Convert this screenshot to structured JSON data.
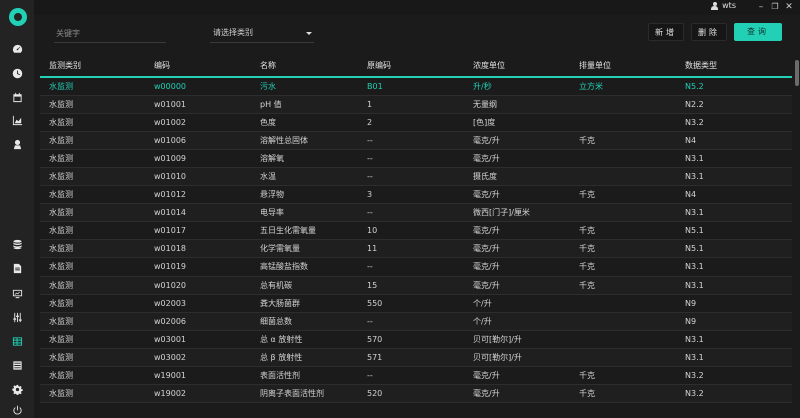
{
  "topbar": {
    "user": "wts"
  },
  "filters": {
    "keyword_placeholder": "关键字",
    "category_placeholder": "请选择类别"
  },
  "actions": {
    "add": "新增",
    "delete": "删除",
    "query": "查询"
  },
  "table": {
    "columns": [
      "监测类别",
      "编码",
      "名称",
      "原编码",
      "浓度单位",
      "排量单位",
      "数据类型"
    ],
    "rows": [
      [
        "水监测",
        "w00000",
        "污水",
        "B01",
        "升/秒",
        "立方米",
        "N5.2"
      ],
      [
        "水监测",
        "w01001",
        "pH 值",
        "1",
        "无量纲",
        "",
        "N2.2"
      ],
      [
        "水监测",
        "w01002",
        "色度",
        "2",
        "[色]度",
        "",
        "N3.2"
      ],
      [
        "水监测",
        "w01006",
        "溶解性总固体",
        "--",
        "毫克/升",
        "千克",
        "N4"
      ],
      [
        "水监测",
        "w01009",
        "溶解氧",
        "--",
        "毫克/升",
        "",
        "N3.1"
      ],
      [
        "水监测",
        "w01010",
        "水温",
        "--",
        "摄氏度",
        "",
        "N3.1"
      ],
      [
        "水监测",
        "w01012",
        "悬浮物",
        "3",
        "毫克/升",
        "千克",
        "N4"
      ],
      [
        "水监测",
        "w01014",
        "电导率",
        "--",
        "微西[门子]/厘米",
        "",
        "N3.1"
      ],
      [
        "水监测",
        "w01017",
        "五日生化需氧量",
        "10",
        "毫克/升",
        "千克",
        "N5.1"
      ],
      [
        "水监测",
        "w01018",
        "化学需氧量",
        "11",
        "毫克/升",
        "千克",
        "N5.1"
      ],
      [
        "水监测",
        "w01019",
        "高锰酸盐指数",
        "--",
        "毫克/升",
        "千克",
        "N3.1"
      ],
      [
        "水监测",
        "w01020",
        "总有机碳",
        "15",
        "毫克/升",
        "千克",
        "N3.1"
      ],
      [
        "水监测",
        "w02003",
        "粪大肠菌群",
        "550",
        "个/升",
        "",
        "N9"
      ],
      [
        "水监测",
        "w02006",
        "细菌总数",
        "--",
        "个/升",
        "",
        "N9"
      ],
      [
        "水监测",
        "w03001",
        "总 α 放射性",
        "570",
        "贝可[勒尔]/升",
        "",
        "N3.1"
      ],
      [
        "水监测",
        "w03002",
        "总 β 放射性",
        "571",
        "贝可[勒尔]/升",
        "",
        "N3.1"
      ],
      [
        "水监测",
        "w19001",
        "表面活性剂",
        "--",
        "毫克/升",
        "千克",
        "N3.2"
      ],
      [
        "水监测",
        "w19002",
        "阴离子表面活性剂",
        "520",
        "毫克/升",
        "千克",
        "N3.2"
      ]
    ]
  },
  "sidebar": {
    "icons": [
      "dashboard-icon",
      "clock-icon",
      "calendar-icon",
      "area-chart-icon",
      "badge-icon",
      "database-icon",
      "document-icon",
      "monitor-icon",
      "sliders-icon",
      "table-grid-icon",
      "list-icon",
      "gear-icon",
      "power-icon"
    ]
  }
}
